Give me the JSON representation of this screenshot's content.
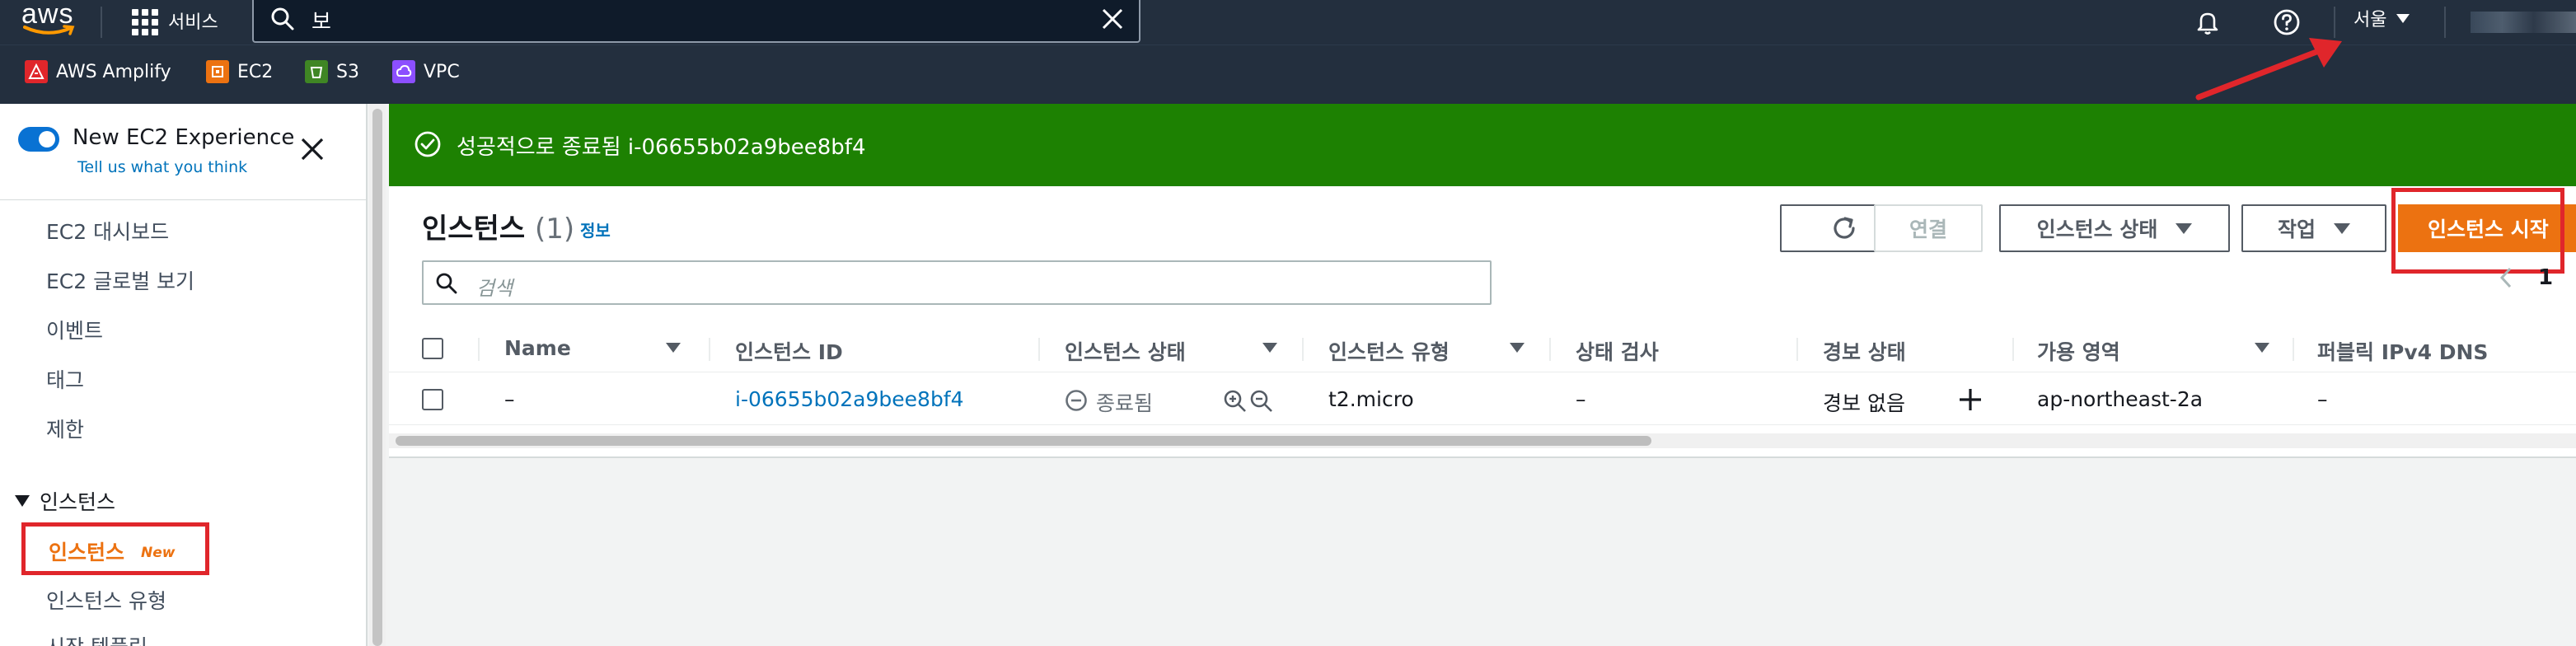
{
  "topnav": {
    "logo_text": "aws",
    "services_label": "서비스",
    "search_value": "보",
    "region_label": "서울"
  },
  "favorites": [
    {
      "label": "AWS Amplify",
      "icon": "amplify-icon",
      "color": "#e0262b"
    },
    {
      "label": "EC2",
      "icon": "ec2-icon",
      "color": "#ec7211"
    },
    {
      "label": "S3",
      "icon": "s3-icon",
      "color": "#3f8624"
    },
    {
      "label": "VPC",
      "icon": "vpc-icon",
      "color": "#8c4fff"
    }
  ],
  "sidebar": {
    "experience_title": "New EC2 Experience",
    "experience_link": "Tell us what you think",
    "items": [
      "EC2 대시보드",
      "EC2 글로벌 보기",
      "이벤트",
      "태그",
      "제한"
    ],
    "section_title": "인스턴스",
    "active_item": "인스턴스",
    "active_badge": "New",
    "sub_items": [
      "인스턴스 유형",
      "시작 템플릿"
    ]
  },
  "flash": {
    "message": "성공적으로 종료됨 i-06655b02a9bee8bf4",
    "color": "#1d8102"
  },
  "panel": {
    "title": "인스턴스",
    "count": "(1)",
    "info_link": "정보",
    "actions": {
      "connect": "연결",
      "instance_state": "인스턴스 상태",
      "actions": "작업",
      "launch": "인스턴스 시작"
    },
    "search_placeholder": "검색",
    "page": "1",
    "columns": [
      "Name",
      "인스턴스 ID",
      "인스턴스 상태",
      "인스턴스 유형",
      "상태 검사",
      "경보 상태",
      "가용 영역",
      "퍼블릭 IPv4 DNS"
    ],
    "rows": [
      {
        "name": "–",
        "instance_id": "i-06655b02a9bee8bf4",
        "state": "종료됨",
        "type": "t2.micro",
        "status_check": "–",
        "alarm": "경보 없음",
        "zone": "ap-northeast-2a",
        "dns": "–"
      }
    ],
    "accent_color": "#ec7211"
  }
}
